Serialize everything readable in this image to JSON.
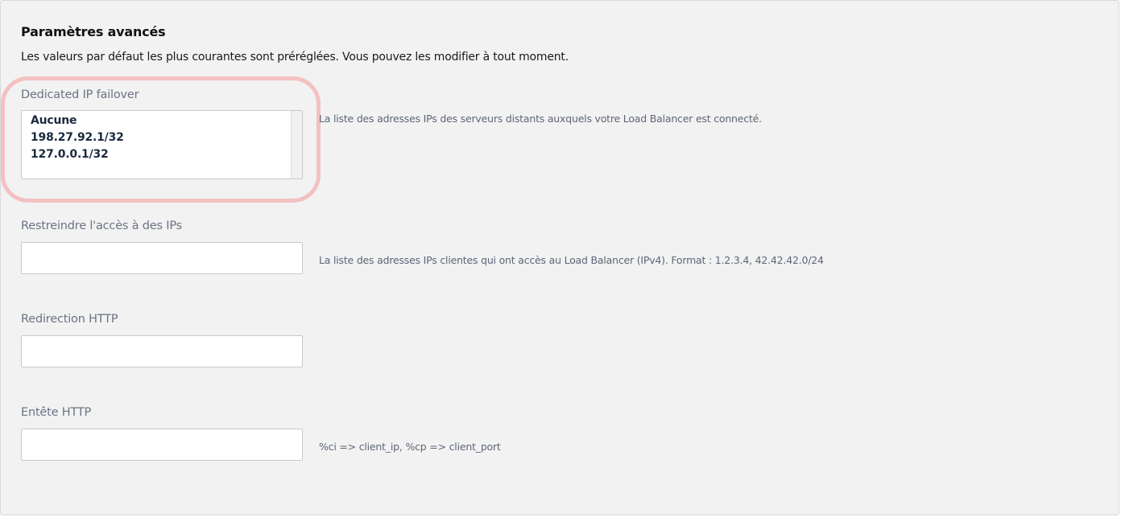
{
  "section": {
    "title": "Paramètres avancés",
    "subtitle": "Les valeurs par défaut les plus courantes sont préréglées. Vous pouvez les modifier à tout moment."
  },
  "failover": {
    "label": "Dedicated IP failover",
    "options": [
      "Aucune",
      "198.27.92.1/32",
      "127.0.0.1/32"
    ],
    "help": "La liste des adresses IPs des serveurs distants auxquels votre Load Balancer est connecté."
  },
  "restrict": {
    "label": "Restreindre l'accès à des IPs",
    "value": "",
    "help": "La liste des adresses IPs clientes qui ont accès au Load Balancer (IPv4). Format : 1.2.3.4, 42.42.42.0/24"
  },
  "redirect": {
    "label": "Redirection HTTP",
    "value": ""
  },
  "header": {
    "label": "Entête HTTP",
    "value": "",
    "help": "%ci => client_ip, %cp => client_port"
  },
  "colors": {
    "highlight": "#f3c1c1",
    "label": "#6b7384",
    "panel_bg": "#f2f2f2"
  }
}
